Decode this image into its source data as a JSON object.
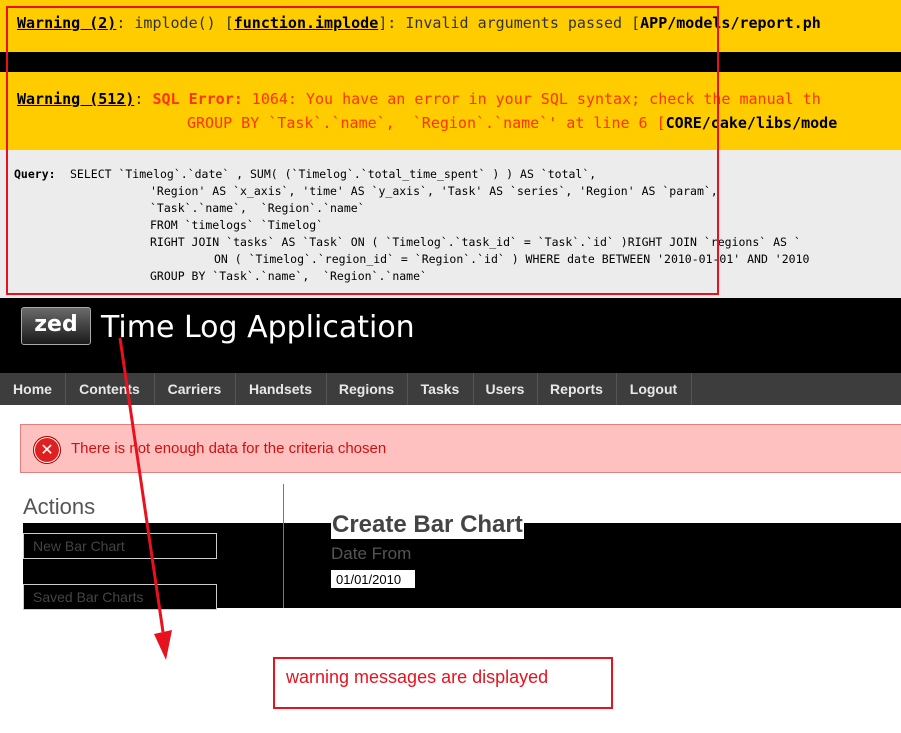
{
  "warning1": {
    "label": "Warning (2)",
    "sep1": ": implode() [",
    "func": "function.implode",
    "sep2": "]: Invalid arguments passed [",
    "path": "APP/models/report.ph"
  },
  "warning2": {
    "label": "Warning (512)",
    "sep": ": ",
    "error_prefix": "SQL Error:",
    "message": " 1064: You have an error in your SQL syntax; check the manual th",
    "line2": "GROUP BY `Task`.`name`,  `Region`.`name`' at line 6 [",
    "path": "CORE/cake/libs/mode"
  },
  "query": {
    "label": "Query:",
    "lines": [
      "SELECT `Timelog`.`date` , SUM( (`Timelog`.`total_time_spent` ) ) AS `total`,",
      "'Region' AS `x_axis`, 'time' AS `y_axis`, 'Task' AS `series`, 'Region' AS `param`,",
      "`Task`.`name`,  `Region`.`name`",
      "FROM `timelogs` `Timelog`",
      "RIGHT JOIN `tasks` AS `Task` ON ( `Timelog`.`task_id` = `Task`.`id` )RIGHT JOIN `regions` AS `",
      "ON ( `Timelog`.`region_id` = `Region`.`id` ) WHERE date BETWEEN '2010-01-01' AND '2010",
      "GROUP BY `Task`.`name`,  `Region`.`name`"
    ]
  },
  "header": {
    "logo": "zed",
    "title": "Time Log Application"
  },
  "nav": [
    "Home",
    "Contents",
    "Carriers",
    "Handsets",
    "Regions",
    "Tasks",
    "Users",
    "Reports",
    "Logout"
  ],
  "flash": {
    "message": "There is not enough data for the criteria chosen"
  },
  "sidebar": {
    "title": "Actions",
    "buttons": [
      "New Bar Chart",
      "Saved Bar Charts"
    ]
  },
  "main": {
    "title": "Create Bar Chart",
    "date_from_label": "Date From",
    "date_from_value": "01/01/2010"
  },
  "annotation": {
    "text": "warning messages are displayed",
    "color": "#e8121f"
  }
}
